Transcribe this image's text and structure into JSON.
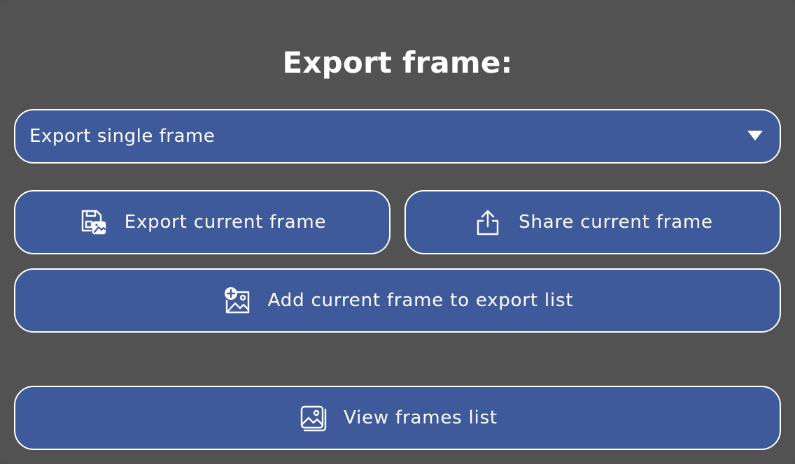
{
  "dialog": {
    "title": "Export frame:"
  },
  "export_mode": {
    "selected": "Export single frame"
  },
  "buttons": {
    "export_current": {
      "label": "Export current frame",
      "icon": "save-image-icon"
    },
    "share_current": {
      "label": "Share current frame",
      "icon": "share-upload-icon"
    },
    "add_to_list": {
      "label": "Add current frame to export list",
      "icon": "add-image-icon"
    },
    "view_list": {
      "label": "View frames list",
      "icon": "image-stack-icon"
    }
  },
  "colors": {
    "background": "#525252",
    "button_fill": "#3f5a9b",
    "button_border": "#ffffff",
    "text": "#ffffff"
  }
}
